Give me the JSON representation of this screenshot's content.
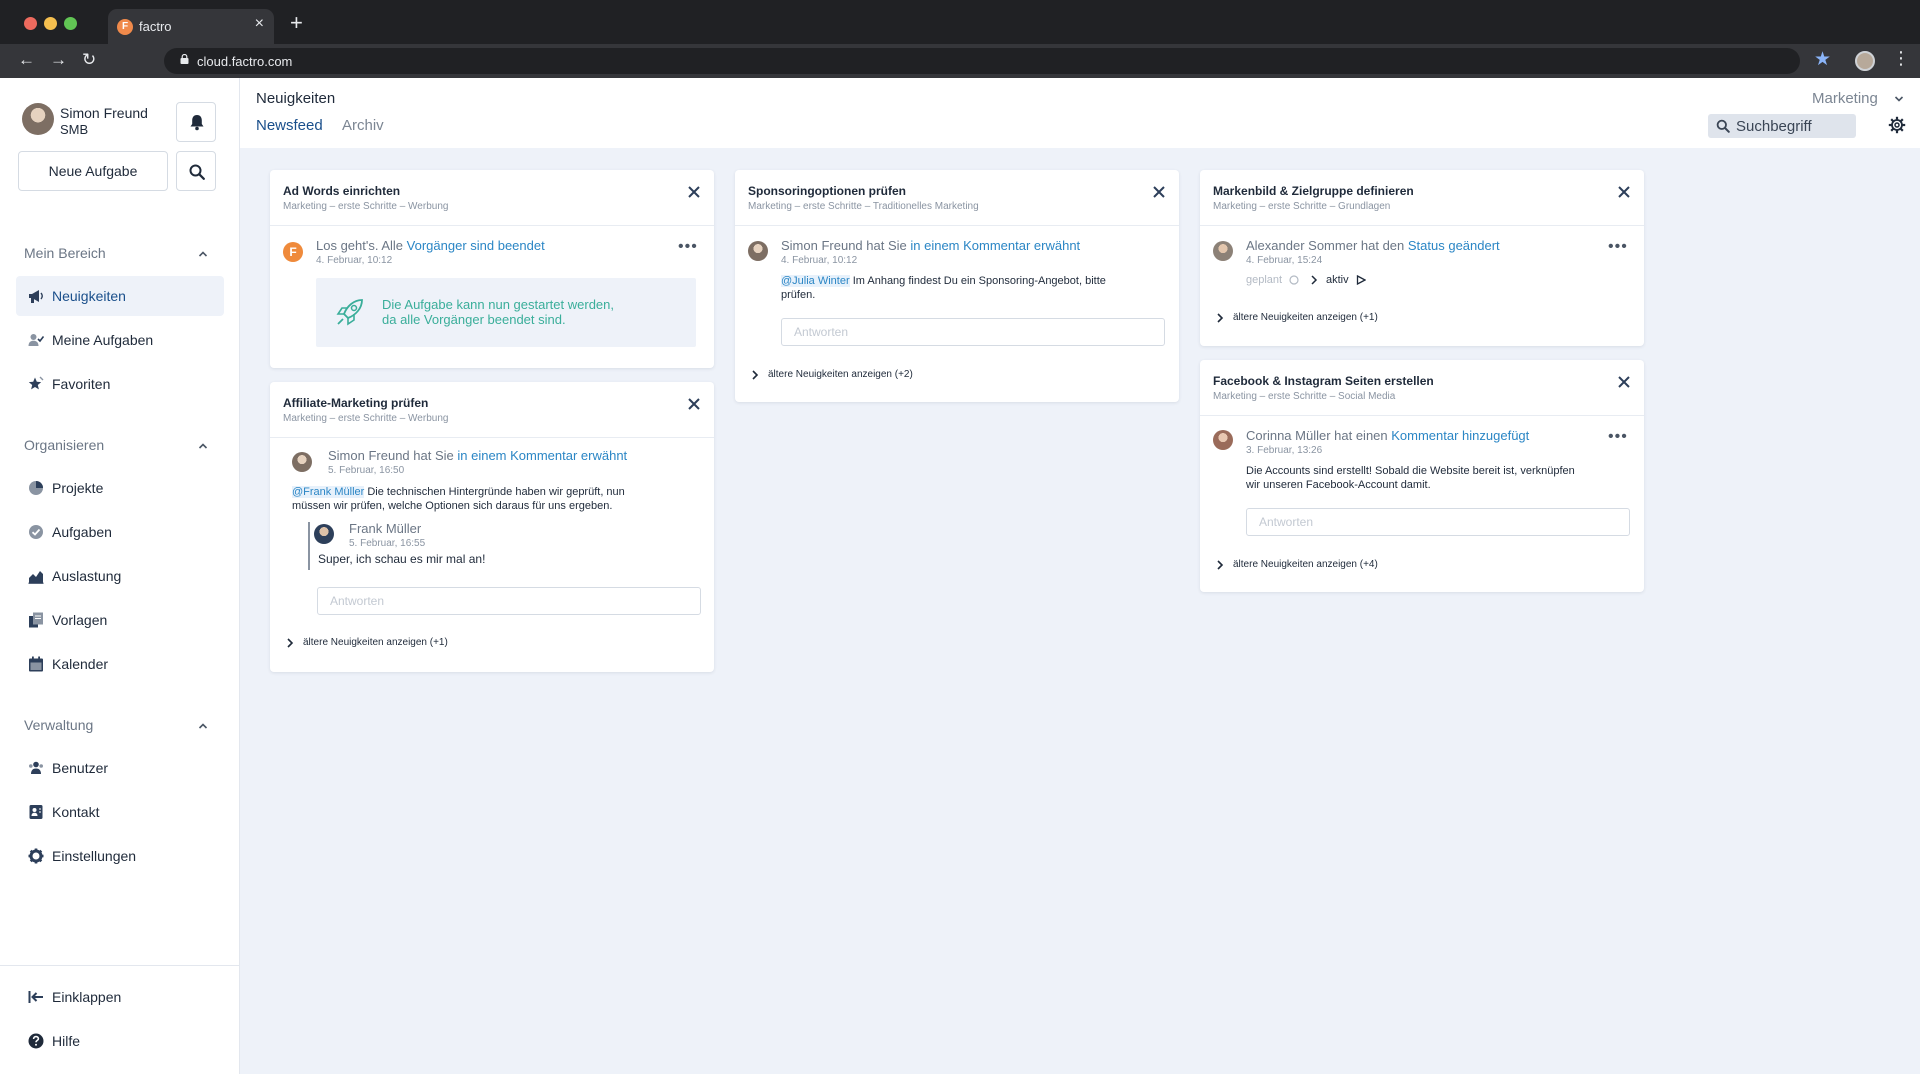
{
  "browser": {
    "tab_title": "factro",
    "favicon_letter": "F",
    "url": "cloud.factro.com"
  },
  "sidebar": {
    "user": {
      "name": "Simon Freund",
      "org": "SMB"
    },
    "new_task_label": "Neue Aufgabe",
    "sections": [
      {
        "title": "Mein Bereich",
        "items": [
          {
            "label": "Neuigkeiten",
            "icon": "megaphone-icon",
            "active": true
          },
          {
            "label": "Meine Aufgaben",
            "icon": "user-check-icon"
          },
          {
            "label": "Favoriten",
            "icon": "star-icon"
          }
        ]
      },
      {
        "title": "Organisieren",
        "items": [
          {
            "label": "Projekte",
            "icon": "pie-icon"
          },
          {
            "label": "Aufgaben",
            "icon": "check-circle-icon"
          },
          {
            "label": "Auslastung",
            "icon": "chart-icon"
          },
          {
            "label": "Vorlagen",
            "icon": "document-icon"
          },
          {
            "label": "Kalender",
            "icon": "calendar-icon"
          }
        ]
      },
      {
        "title": "Verwaltung",
        "items": [
          {
            "label": "Benutzer",
            "icon": "users-icon"
          },
          {
            "label": "Kontakt",
            "icon": "contact-icon"
          },
          {
            "label": "Einstellungen",
            "icon": "gear-icon"
          }
        ]
      }
    ],
    "footer": [
      {
        "label": "Einklappen",
        "icon": "collapse-icon"
      },
      {
        "label": "Hilfe",
        "icon": "help-icon"
      }
    ]
  },
  "header": {
    "title": "Neuigkeiten",
    "tabs": [
      {
        "label": "Newsfeed",
        "active": true
      },
      {
        "label": "Archiv",
        "active": false
      }
    ],
    "workspace": "Marketing",
    "search_placeholder": "Suchbegriff"
  },
  "colors": {
    "accent": "#1a4f8b",
    "link": "#2b86c5",
    "info_text": "#3aae9a",
    "badge": "#ef8a3b",
    "background": "#eef2f9"
  },
  "cards": {
    "adwords": {
      "title": "Ad Words einrichten",
      "path": "Marketing – erste Schritte – Werbung",
      "entry_text": "Los geht's. Alle ",
      "entry_link": "Vorgänger sind beendet",
      "entry_time": "4. Februar, 10:12",
      "info_line1": "Die Aufgabe kann nun gestartet werden,",
      "info_line2": "da alle Vorgänger beendet sind."
    },
    "affiliate": {
      "title": "Affiliate-Marketing prüfen",
      "path": "Marketing – erste Schritte – Werbung",
      "entry_text": "Simon Freund hat Sie ",
      "entry_link": "in einem Kommentar erwähnt",
      "entry_time": "5. Februar, 16:50",
      "mention": "@Frank Müller",
      "body_line1": " Die technischen Hintergründe haben wir geprüft, nun",
      "body_line2": "müssen wir prüfen, welche Optionen sich daraus für uns ergeben.",
      "reply_author": "Frank Müller",
      "reply_time": "5. Februar, 16:55",
      "reply_text": "Super, ich schau es mir mal an!",
      "reply_placeholder": "Antworten",
      "older": "ältere Neuigkeiten anzeigen (+1)"
    },
    "sponsoring": {
      "title": "Sponsoringoptionen prüfen",
      "path": "Marketing – erste Schritte – Traditionelles Marketing",
      "entry_text": "Simon Freund hat Sie ",
      "entry_link": "in einem Kommentar erwähnt",
      "entry_time": "4. Februar, 10:12",
      "mention": "@Julia Winter",
      "body_line1": " Im Anhang findest Du ein Sponsoring-Angebot, bitte",
      "body_line2": "prüfen.",
      "reply_placeholder": "Antworten",
      "older": "ältere Neuigkeiten anzeigen (+2)"
    },
    "markenbild": {
      "title": "Markenbild & Zielgruppe definieren",
      "path": "Marketing – erste Schritte – Grundlagen",
      "entry_text": "Alexander Sommer hat den ",
      "entry_link": "Status geändert",
      "entry_time": "4. Februar, 15:24",
      "status_from": "geplant",
      "status_to": "aktiv",
      "older": "ältere Neuigkeiten anzeigen (+1)"
    },
    "facebook": {
      "title": "Facebook & Instagram Seiten erstellen",
      "path": "Marketing – erste Schritte – Social Media",
      "entry_text": "Corinna Müller hat einen ",
      "entry_link": "Kommentar hinzugefügt",
      "entry_time": "3. Februar, 13:26",
      "body_line1": "Die Accounts sind erstellt! Sobald die Website bereit ist, verknüpfen",
      "body_line2": "wir unseren Facebook-Account damit.",
      "reply_placeholder": "Antworten",
      "older": "ältere Neuigkeiten anzeigen (+4)"
    }
  }
}
